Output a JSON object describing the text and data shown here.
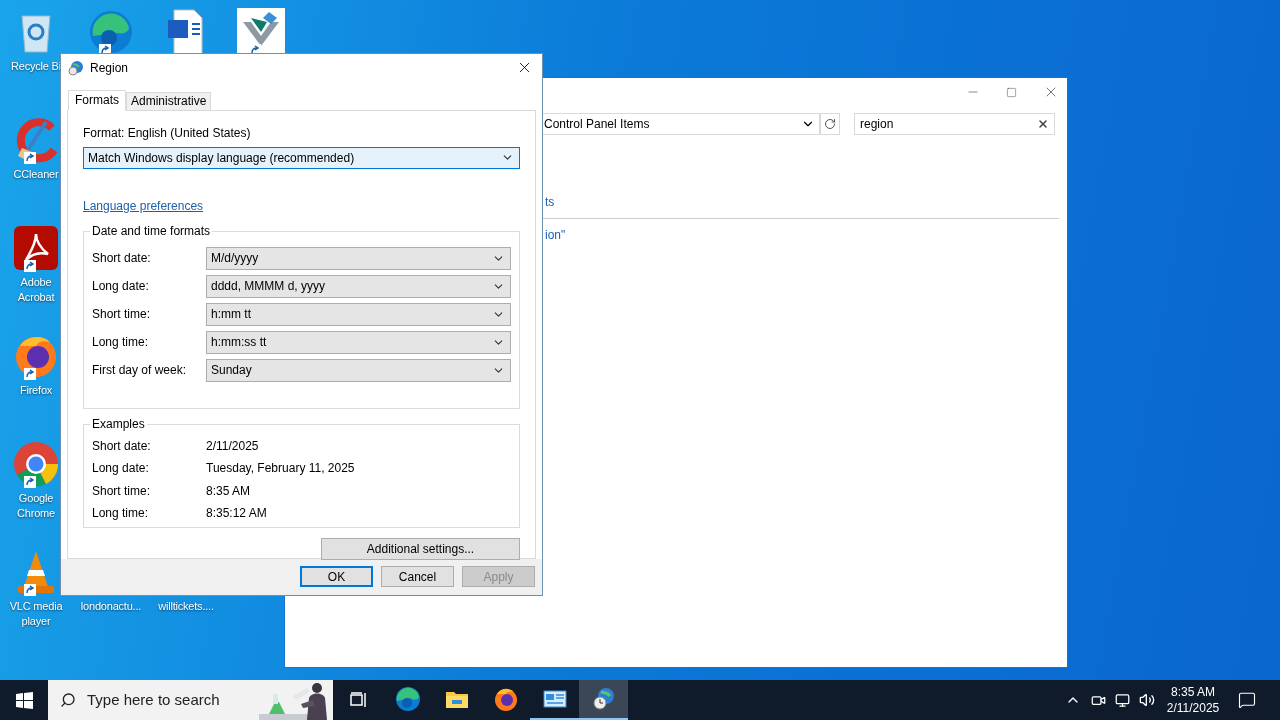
{
  "desktop_icons": [
    {
      "kind": "recycle",
      "label": "Recycle Bi"
    },
    {
      "kind": "edge",
      "shortcut": true
    },
    {
      "kind": "word"
    },
    {
      "kind": "app",
      "shortcut": true
    },
    {
      "kind": "ccleaner",
      "label": "CCleaner",
      "shortcut": true
    },
    {
      "kind": "acrobat",
      "label": "Adobe Acrobat",
      "shortcut": true
    },
    {
      "kind": "firefox",
      "label": "Firefox",
      "shortcut": true
    },
    {
      "kind": "chrome",
      "label": "Google Chrome",
      "shortcut": true
    },
    {
      "kind": "vlc",
      "label": "VLC media player",
      "shortcut": true
    },
    {
      "kind": "file",
      "label": "londonactu..."
    },
    {
      "kind": "file",
      "label": "willtickets...."
    }
  ],
  "background_window": {
    "address": "Control Panel Items",
    "search": "region",
    "links": [
      "ts",
      "ion\""
    ]
  },
  "dialog": {
    "title": "Region",
    "tabs": [
      {
        "label": "Formats",
        "selected": true
      },
      {
        "label": "Administrative",
        "selected": false
      }
    ],
    "format_label": "Format: English (United States)",
    "format_value": "Match Windows display language (recommended)",
    "link": "Language preferences",
    "formats_group": {
      "title": "Date and time formats",
      "rows": [
        {
          "label": "Short date:",
          "value": "M/d/yyyy"
        },
        {
          "label": "Long date:",
          "value": "dddd, MMMM d, yyyy"
        },
        {
          "label": "Short time:",
          "value": "h:mm tt"
        },
        {
          "label": "Long time:",
          "value": "h:mm:ss tt"
        },
        {
          "label": "First day of week:",
          "value": "Sunday"
        }
      ]
    },
    "examples_group": {
      "title": "Examples",
      "rows": [
        {
          "label": "Short date:",
          "value": "2/11/2025"
        },
        {
          "label": "Long date:",
          "value": "Tuesday, February 11, 2025"
        },
        {
          "label": "Short time:",
          "value": "8:35 AM"
        },
        {
          "label": "Long time:",
          "value": "8:35:12 AM"
        }
      ]
    },
    "additional_button": "Additional settings...",
    "buttons": [
      {
        "label": "OK",
        "default": true,
        "disabled": false
      },
      {
        "label": "Cancel",
        "default": false,
        "disabled": false
      },
      {
        "label": "Apply",
        "default": false,
        "disabled": true
      }
    ]
  },
  "taskbar": {
    "search_placeholder": "Type here to search",
    "apps": [
      {
        "kind": "edge",
        "running": false,
        "selected": false
      },
      {
        "kind": "explorer",
        "running": false,
        "selected": false
      },
      {
        "kind": "firefox",
        "running": false,
        "selected": false
      },
      {
        "kind": "control-panel",
        "running": true,
        "selected": false
      },
      {
        "kind": "region",
        "running": true,
        "selected": true
      }
    ],
    "time": "8:35 AM",
    "date": "2/11/2025"
  }
}
